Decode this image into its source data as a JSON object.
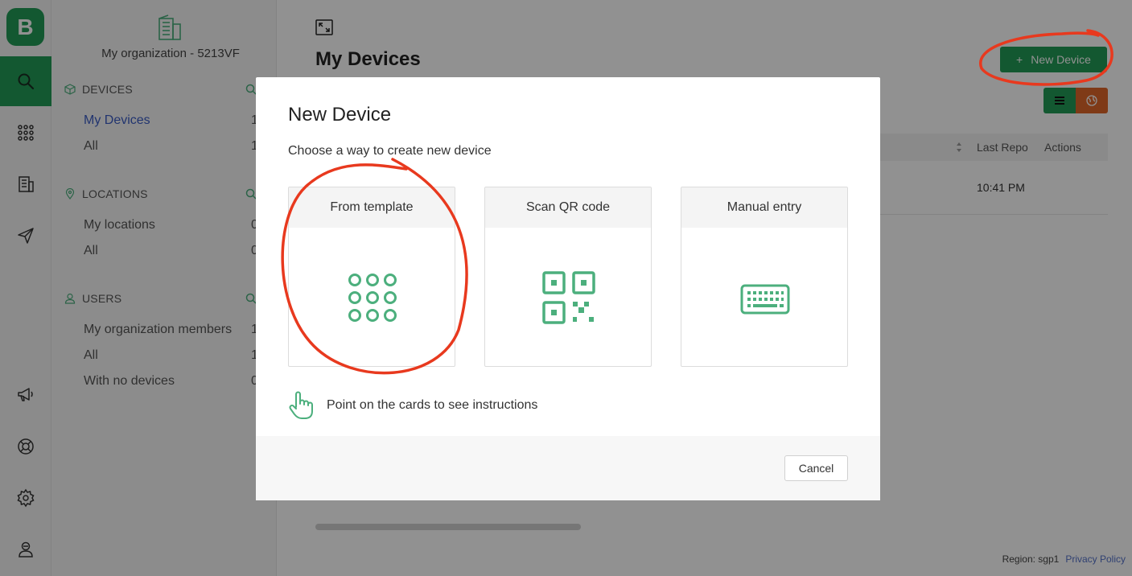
{
  "app": {
    "logo_letter": "B"
  },
  "rail": {
    "items": [
      {
        "icon": "search-icon",
        "active": true
      },
      {
        "icon": "grid-dots-icon",
        "active": false
      },
      {
        "icon": "building-icon",
        "active": false
      },
      {
        "icon": "send-icon",
        "active": false
      },
      {
        "icon": "megaphone-icon",
        "active": false
      },
      {
        "icon": "lifebuoy-icon",
        "active": false
      },
      {
        "icon": "gear-icon",
        "active": false
      },
      {
        "icon": "user-profile-icon",
        "active": false
      }
    ]
  },
  "sidebar": {
    "org_name": "My organization - 5213VF",
    "sections": [
      {
        "title": "DEVICES",
        "icon": "cube-icon",
        "items": [
          {
            "label": "My Devices",
            "count": "1",
            "selected": true
          },
          {
            "label": "All",
            "count": "1",
            "selected": false
          }
        ]
      },
      {
        "title": "LOCATIONS",
        "icon": "pin-icon",
        "items": [
          {
            "label": "My locations",
            "count": "0"
          },
          {
            "label": "All",
            "count": "0"
          }
        ]
      },
      {
        "title": "USERS",
        "icon": "user-icon",
        "items": [
          {
            "label": "My organization members",
            "count": "1"
          },
          {
            "label": "All",
            "count": "1"
          },
          {
            "label": "With no devices",
            "count": "0"
          }
        ]
      }
    ]
  },
  "main": {
    "title": "My Devices",
    "new_button": "New Device",
    "columns": {
      "last_reported": "Last Repo",
      "actions": "Actions"
    },
    "row": {
      "last_reported": "10:41 PM"
    },
    "footer": {
      "region": "Region: sgp1",
      "privacy": "Privacy Policy"
    }
  },
  "modal": {
    "title": "New Device",
    "subtitle": "Choose a way to create new device",
    "cards": [
      {
        "label": "From template",
        "icon": "template-grid-icon"
      },
      {
        "label": "Scan QR code",
        "icon": "qr-code-icon"
      },
      {
        "label": "Manual entry",
        "icon": "keyboard-icon"
      }
    ],
    "hint": "Point on the cards to see instructions",
    "cancel": "Cancel"
  },
  "colors": {
    "brand": "#239b56",
    "icon_green": "#4caf7d",
    "annotation_red": "#e8391e",
    "map_orange": "#e0662a"
  }
}
